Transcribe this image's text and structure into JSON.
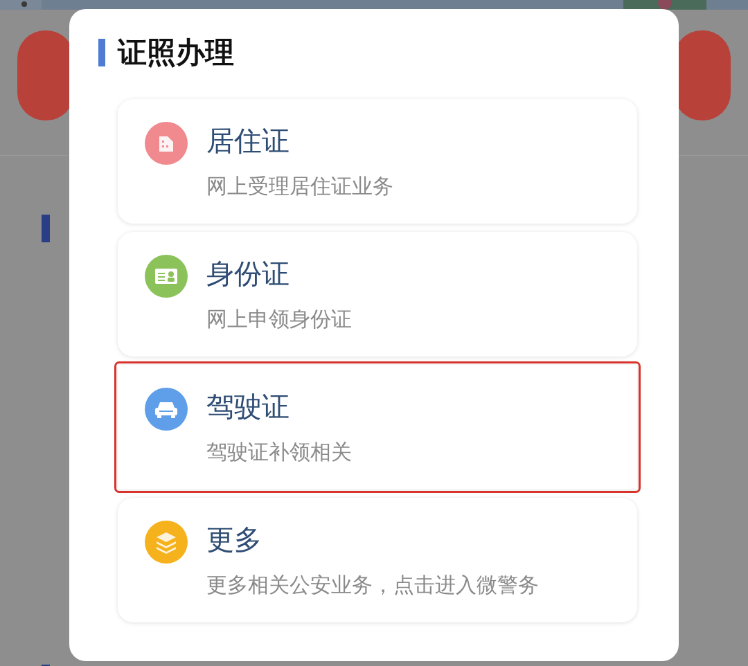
{
  "dialog": {
    "title": "证照办理",
    "items": [
      {
        "kind": "building",
        "color": "#f08a8f",
        "title": "居住证",
        "subtitle": "网上受理居住证业务",
        "highlighted": false
      },
      {
        "kind": "id-card",
        "color": "#8cc25a",
        "title": "身份证",
        "subtitle": "网上申领身份证",
        "highlighted": false
      },
      {
        "kind": "car",
        "color": "#5f9ee8",
        "title": "驾驶证",
        "subtitle": "驾驶证补领相关",
        "highlighted": true
      },
      {
        "kind": "layers",
        "color": "#f5b21c",
        "title": "更多",
        "subtitle": "更多相关公安业务，点击进入微警务",
        "highlighted": false
      }
    ]
  }
}
